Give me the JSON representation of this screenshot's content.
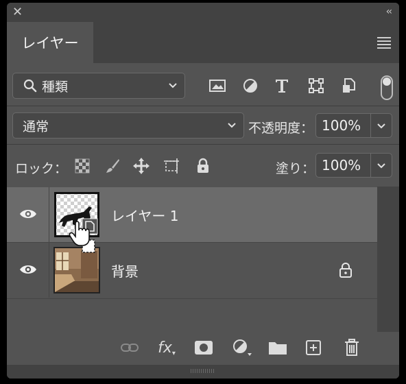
{
  "window": {
    "close_glyph": "✕",
    "collapse_glyph": "‹‹"
  },
  "tab": {
    "label": "レイヤー"
  },
  "filter": {
    "icon": "search-icon",
    "label": "種類"
  },
  "blend": {
    "mode": "通常",
    "opacity_label": "不透明度：",
    "opacity_value": "100%"
  },
  "lock": {
    "label": "ロック：",
    "fill_label": "塗り：",
    "fill_value": "100%"
  },
  "layers": [
    {
      "name": "レイヤー 1",
      "selected": true,
      "visible": true
    },
    {
      "name": "背景",
      "selected": false,
      "visible": true,
      "locked": true
    }
  ],
  "footer": {
    "fx_label": "fx"
  },
  "colors": {
    "panel": "#535353",
    "header": "#424242",
    "selected_row": "#6b6b6b"
  }
}
